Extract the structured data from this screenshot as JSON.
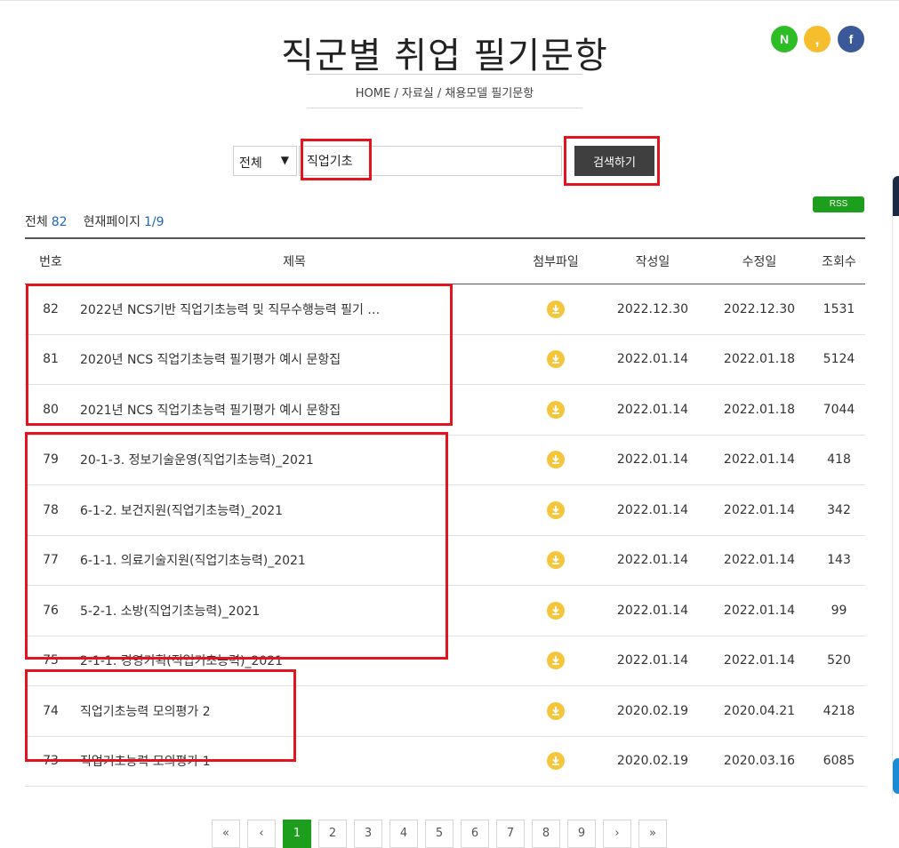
{
  "page": {
    "title": "직군별 취업 필기문항",
    "breadcrumb": "HOME / 자료실 / 채용모델 필기문항"
  },
  "social": [
    "N",
    ",",
    "f"
  ],
  "search": {
    "scope_value": "전체",
    "keyword": "직업기초",
    "button_label": "검색하기"
  },
  "summary": {
    "total_label": "전체",
    "total_count": "82",
    "page_label": "현재페이지",
    "page_value": "1/9",
    "rss_label": "RSS"
  },
  "table": {
    "headers": [
      "번호",
      "제목",
      "첨부파일",
      "작성일",
      "수정일",
      "조회수"
    ],
    "rows": [
      {
        "no": "82",
        "title": "2022년 NCS기반 직업기초능력 및 직무수행능력 필기 …",
        "created": "2022.12.30",
        "updated": "2022.12.30",
        "views": "1531"
      },
      {
        "no": "81",
        "title": "2020년 NCS 직업기초능력 필기평가 예시 문항집",
        "created": "2022.01.14",
        "updated": "2022.01.18",
        "views": "5124"
      },
      {
        "no": "80",
        "title": "2021년 NCS 직업기초능력 필기평가 예시 문항집",
        "created": "2022.01.14",
        "updated": "2022.01.18",
        "views": "7044"
      },
      {
        "no": "79",
        "title": "20-1-3. 정보기술운영(직업기초능력)_2021",
        "created": "2022.01.14",
        "updated": "2022.01.14",
        "views": "418"
      },
      {
        "no": "78",
        "title": "6-1-2. 보건지원(직업기초능력)_2021",
        "created": "2022.01.14",
        "updated": "2022.01.14",
        "views": "342"
      },
      {
        "no": "77",
        "title": "6-1-1. 의료기술지원(직업기초능력)_2021",
        "created": "2022.01.14",
        "updated": "2022.01.14",
        "views": "143"
      },
      {
        "no": "76",
        "title": "5-2-1. 소방(직업기초능력)_2021",
        "created": "2022.01.14",
        "updated": "2022.01.14",
        "views": "99"
      },
      {
        "no": "75",
        "title": "2-1-1. 경영기획(직업기초능력)_2021",
        "created": "2022.01.14",
        "updated": "2022.01.14",
        "views": "520"
      },
      {
        "no": "74",
        "title": "직업기초능력 모의평가 2",
        "created": "2020.02.19",
        "updated": "2020.04.21",
        "views": "4218"
      },
      {
        "no": "73",
        "title": "직업기초능력 모의평가 1",
        "created": "2020.02.19",
        "updated": "2020.03.16",
        "views": "6085"
      }
    ]
  },
  "pagination": [
    "«",
    "‹",
    "1",
    "2",
    "3",
    "4",
    "5",
    "6",
    "7",
    "8",
    "9",
    "›",
    "»"
  ],
  "colors": {
    "highlight_box": "#e3141e",
    "accent_green": "#1d9f1d",
    "download_icon": "#f5c63b",
    "count_blue": "#1f67b5"
  }
}
